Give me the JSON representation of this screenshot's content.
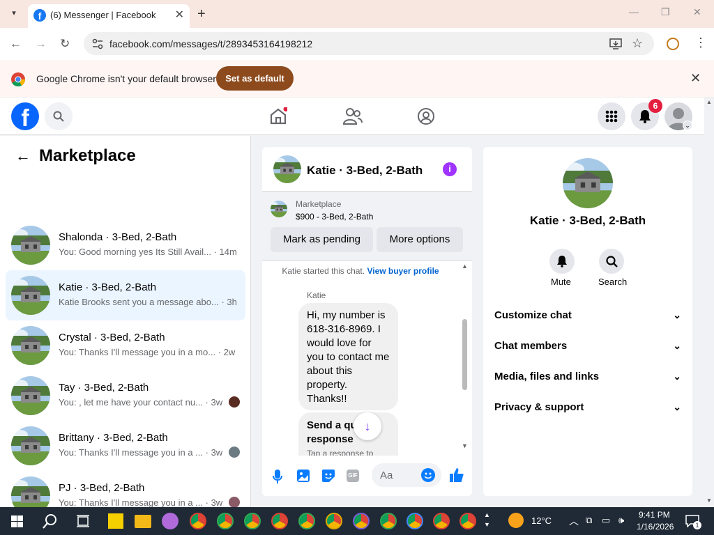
{
  "browser": {
    "tab_title": "(6) Messenger | Facebook",
    "url": "facebook.com/messages/t/2893453164198212",
    "banner_text": "Google Chrome isn't your default browser",
    "banner_button": "Set as default"
  },
  "fb": {
    "notification_count": "6"
  },
  "sidebar": {
    "title": "Marketplace",
    "conversations": [
      {
        "name": "Shalonda · 3-Bed, 2-Bath",
        "preview": "You: Good morning yes Its Still Avail...",
        "time": "· 14m"
      },
      {
        "name": "Katie · 3-Bed, 2-Bath",
        "preview": "Katie Brooks sent you a message abo...",
        "time": "· 3h"
      },
      {
        "name": "Crystal · 3-Bed, 2-Bath",
        "preview": "You: Thanks I'll message you in a mo...",
        "time": "· 2w"
      },
      {
        "name": "Tay · 3-Bed, 2-Bath",
        "preview": "You: , let me have your contact nu...",
        "time": "· 3w"
      },
      {
        "name": "Brittany · 3-Bed, 2-Bath",
        "preview": "You: Thanks I'll message you in a ...",
        "time": "· 3w"
      },
      {
        "name": "PJ · 3-Bed, 2-Bath",
        "preview": "You: Thanks I'll message you in a ...",
        "time": "· 3w"
      }
    ]
  },
  "chat": {
    "title": "Katie · 3-Bed, 2-Bath",
    "listing_source": "Marketplace",
    "listing": "$900 - 3-Bed, 2-Bath",
    "mark_pending": "Mark as pending",
    "more_options": "More options",
    "started_text": "Katie started this chat.",
    "view_profile": "View buyer profile",
    "sender": "Katie",
    "message": "Hi, my number is 618-316-8969. I would love for you to contact me about this property. Thanks!!",
    "quick_title": "Send a quick response",
    "quick_sub": "Tap a response to",
    "composer_placeholder": "Aa"
  },
  "details": {
    "name": "Katie · 3-Bed, 2-Bath",
    "mute": "Mute",
    "search": "Search",
    "sections": [
      "Customize chat",
      "Chat members",
      "Media, files and links",
      "Privacy & support"
    ]
  },
  "taskbar": {
    "temp": "12°C",
    "time": "9:41 PM",
    "date": "1/16/2026",
    "notif_count": "1"
  }
}
